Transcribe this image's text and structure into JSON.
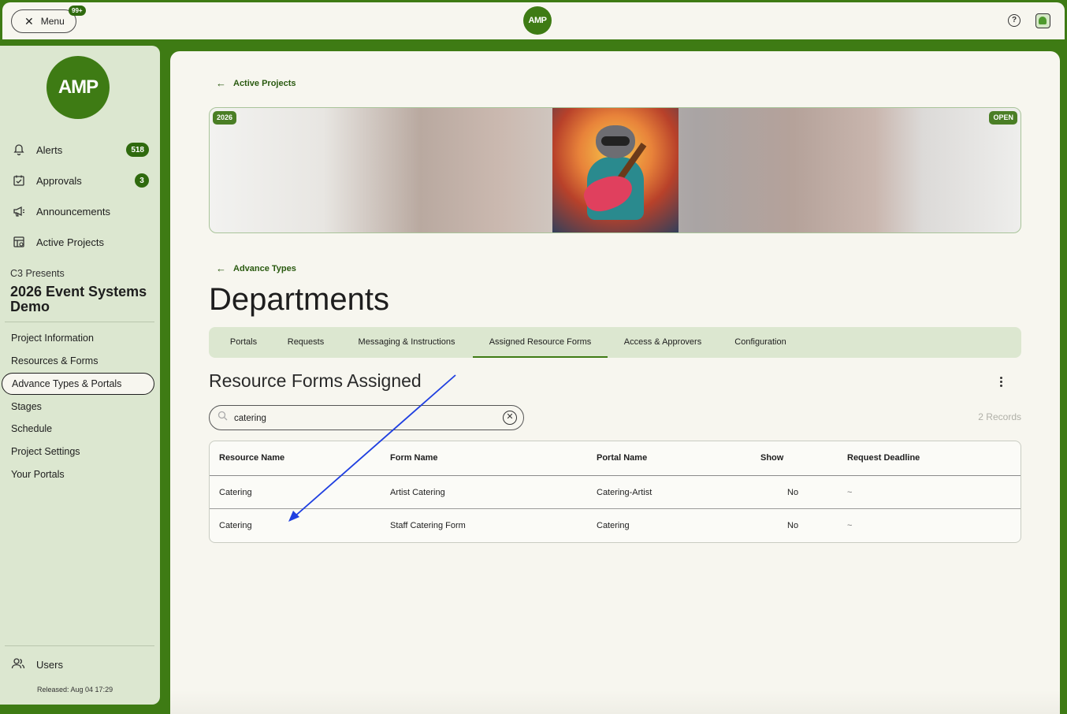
{
  "topbar": {
    "menu_label": "Menu",
    "menu_badge": "99+",
    "logo_text": "AMP",
    "help_icon": "help-circle-icon",
    "avatar_icon": "user-avatar-icon"
  },
  "sidebar": {
    "logo_text": "AMP",
    "nav": [
      {
        "label": "Alerts",
        "count": "518",
        "icon": "bell-icon"
      },
      {
        "label": "Approvals",
        "count": "3",
        "icon": "calendar-check-icon"
      },
      {
        "label": "Announcements",
        "icon": "megaphone-icon"
      },
      {
        "label": "Active Projects",
        "icon": "project-board-icon"
      }
    ],
    "project_org": "C3 Presents",
    "project_title": "2026 Event Systems Demo",
    "project_items": [
      {
        "label": "Project Information"
      },
      {
        "label": "Resources & Forms"
      },
      {
        "label": "Advance Types & Portals",
        "active": true
      },
      {
        "label": "Stages"
      },
      {
        "label": "Schedule"
      },
      {
        "label": "Project Settings"
      },
      {
        "label": "Your Portals"
      }
    ],
    "users_label": "Users",
    "released": "Released: Aug 04 17:29"
  },
  "main": {
    "back_active_projects": "Active Projects",
    "banner_year": "2026",
    "banner_status": "OPEN",
    "back_advance_types": "Advance Types",
    "page_title": "Departments",
    "tabs": [
      {
        "label": "Portals"
      },
      {
        "label": "Requests"
      },
      {
        "label": "Messaging & Instructions"
      },
      {
        "label": "Assigned Resource Forms",
        "active": true
      },
      {
        "label": "Access & Approvers"
      },
      {
        "label": "Configuration"
      }
    ],
    "section_title": "Resource Forms Assigned",
    "search": {
      "value": "catering",
      "placeholder": "Search"
    },
    "records": "2 Records",
    "table": {
      "headers": [
        "Resource Name",
        "Form Name",
        "Portal Name",
        "Show",
        "Request Deadline"
      ],
      "rows": [
        [
          "Catering",
          "Artist Catering",
          "Catering-Artist",
          "No",
          "~"
        ],
        [
          "Catering",
          "Staff Catering Form",
          "Catering",
          "No",
          "~"
        ]
      ]
    }
  },
  "colors": {
    "brand_green": "#3e7b14",
    "sidebar_bg": "#dce7d0",
    "panel_bg": "#f7f6ef",
    "annotation_arrow": "#1f3fe0"
  }
}
